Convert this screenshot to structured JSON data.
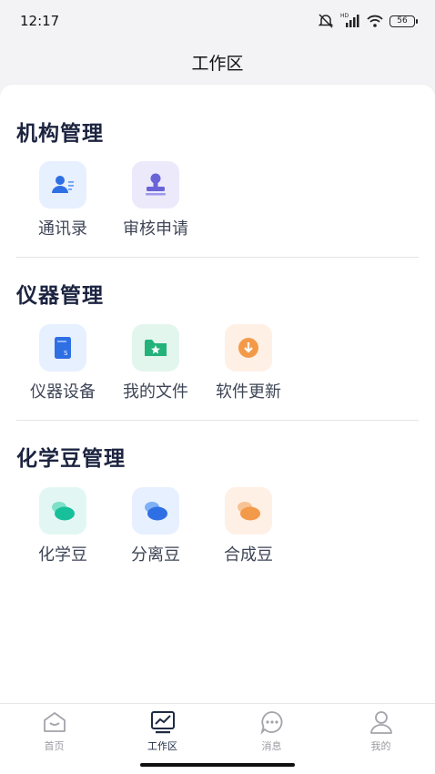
{
  "status_bar": {
    "time": "12:17",
    "network_label": "HD",
    "battery": "56"
  },
  "header": {
    "title": "工作区"
  },
  "sections": [
    {
      "title": "机构管理",
      "items": [
        {
          "label": "通讯录",
          "icon": "contacts-icon"
        },
        {
          "label": "审核申请",
          "icon": "approval-stamp-icon"
        }
      ]
    },
    {
      "title": "仪器管理",
      "items": [
        {
          "label": "仪器设备",
          "icon": "instrument-book-icon"
        },
        {
          "label": "我的文件",
          "icon": "folder-star-icon"
        },
        {
          "label": "软件更新",
          "icon": "download-icon"
        }
      ]
    },
    {
      "title": "化学豆管理",
      "items": [
        {
          "label": "化学豆",
          "icon": "bean-teal-icon"
        },
        {
          "label": "分离豆",
          "icon": "bean-blue-icon"
        },
        {
          "label": "合成豆",
          "icon": "bean-orange-icon"
        }
      ]
    }
  ],
  "tab_bar": {
    "active": "工作区",
    "tabs": [
      {
        "label": "首页",
        "icon": "home-icon"
      },
      {
        "label": "工作区",
        "icon": "workspace-chart-icon"
      },
      {
        "label": "消息",
        "icon": "message-icon"
      },
      {
        "label": "我的",
        "icon": "profile-icon"
      }
    ]
  },
  "colors": {
    "title": "#1c2440",
    "contacts_bg": "#e7f0ff",
    "approval_bg": "#ece9fb",
    "instrument_bg": "#e7f0ff",
    "folder_bg": "#e3f6ee",
    "update_bg": "#fff0e6",
    "bean_teal_bg": "#e2f7f3",
    "bean_blue_bg": "#e7f0ff",
    "bean_orange_bg": "#fff0e6"
  }
}
